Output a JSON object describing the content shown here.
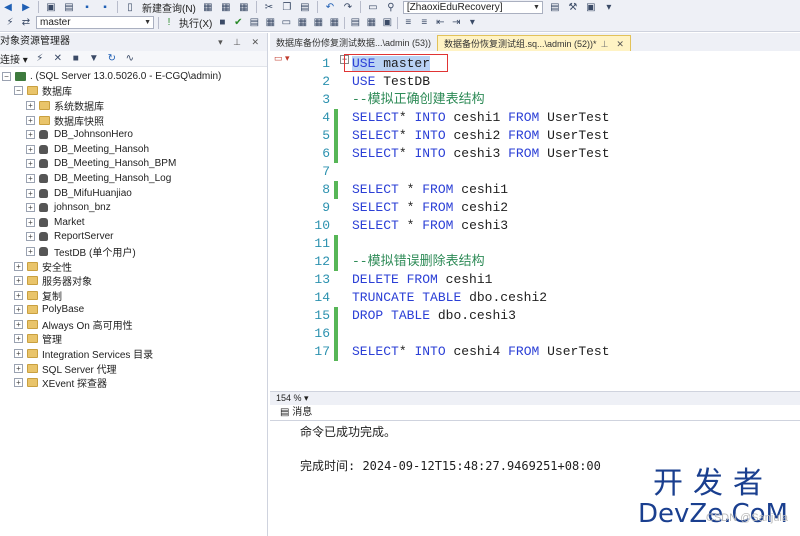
{
  "toolbar": {
    "new_query": "新建查询(N)",
    "database": "master",
    "execute": "执行(X)",
    "solution": "[ZhaoxiEduRecovery]"
  },
  "object_explorer": {
    "title": "对象资源管理器",
    "connect": "连接",
    "server": ". (SQL Server 13.0.5026.0 - E-CGQ\\admin)",
    "databases": "数据库",
    "items": [
      {
        "label": "系统数据库",
        "type": "folder"
      },
      {
        "label": "数据库快照",
        "type": "folder"
      },
      {
        "label": "DB_JohnsonHero",
        "type": "db"
      },
      {
        "label": "DB_Meeting_Hansoh",
        "type": "db"
      },
      {
        "label": "DB_Meeting_Hansoh_BPM",
        "type": "db"
      },
      {
        "label": "DB_Meeting_Hansoh_Log",
        "type": "db"
      },
      {
        "label": "DB_MifuHuanjiao",
        "type": "db"
      },
      {
        "label": "johnson_bnz",
        "type": "db"
      },
      {
        "label": "Market",
        "type": "db"
      },
      {
        "label": "ReportServer",
        "type": "db"
      },
      {
        "label": "TestDB (单个用户)",
        "type": "db"
      }
    ],
    "top_items": [
      {
        "label": "安全性"
      },
      {
        "label": "服务器对象"
      },
      {
        "label": "复制"
      },
      {
        "label": "PolyBase"
      },
      {
        "label": "Always On 高可用性"
      },
      {
        "label": "管理"
      },
      {
        "label": "Integration Services 目录"
      },
      {
        "label": "SQL Server 代理"
      },
      {
        "label": "XEvent 探查器"
      }
    ]
  },
  "tabs": [
    {
      "label": "数据库备份修复测试数据...\\admin (53))",
      "active": false
    },
    {
      "label": "数据备份恢复测试组.sq...\\admin (52))*",
      "active": true
    }
  ],
  "editor": {
    "lines": [
      {
        "n": "1",
        "text": "USE master"
      },
      {
        "n": "2",
        "text": "USE TestDB"
      },
      {
        "n": "3",
        "text": "--模拟正确创建表结构"
      },
      {
        "n": "4",
        "text": "SELECT* INTO ceshi1 FROM UserTest"
      },
      {
        "n": "5",
        "text": "SELECT* INTO ceshi2 FROM UserTest"
      },
      {
        "n": "6",
        "text": "SELECT* INTO ceshi3 FROM UserTest"
      },
      {
        "n": "7",
        "text": ""
      },
      {
        "n": "8",
        "text": "SELECT * FROM ceshi1"
      },
      {
        "n": "9",
        "text": "SELECT * FROM ceshi2"
      },
      {
        "n": "10",
        "text": "SELECT * FROM ceshi3"
      },
      {
        "n": "11",
        "text": ""
      },
      {
        "n": "12",
        "text": "--模拟错误删除表结构"
      },
      {
        "n": "13",
        "text": "DELETE FROM ceshi1"
      },
      {
        "n": "14",
        "text": "TRUNCATE TABLE dbo.ceshi2"
      },
      {
        "n": "15",
        "text": "DROP TABLE dbo.ceshi3"
      },
      {
        "n": "16",
        "text": ""
      },
      {
        "n": "17",
        "text": "SELECT* INTO ceshi4 FROM UserTest"
      }
    ],
    "zoom": "154 %"
  },
  "messages": {
    "tab": "消息",
    "line1": "命令已成功完成。",
    "line2": "完成时间: 2024-09-12T15:48:27.9469251+08:00"
  },
  "watermark": {
    "cn": "开发者",
    "en": "DevZe.CoM",
    "csdn": "CSDN @Sanjula"
  }
}
